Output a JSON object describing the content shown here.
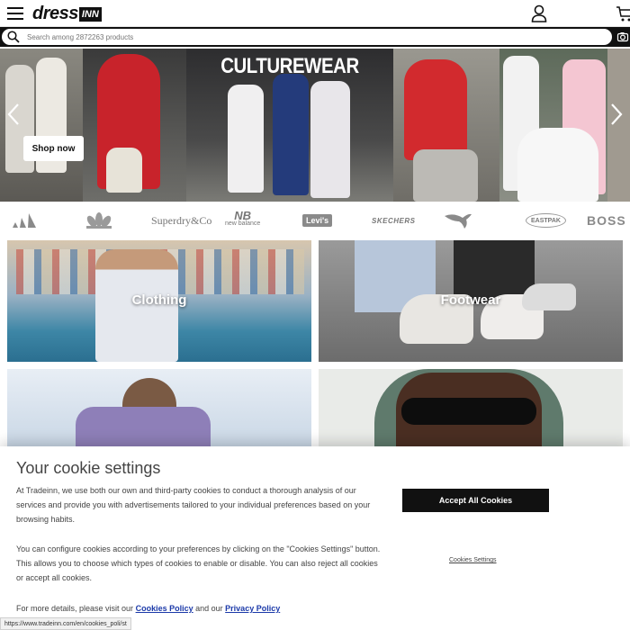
{
  "header": {
    "logo_main": "dress",
    "logo_box": "INN",
    "menu_icon": "hamburger-menu-icon",
    "account_icon": "user-icon",
    "cart_icon": "cart-icon"
  },
  "search": {
    "placeholder": "Search among 2872263 products",
    "icon": "search-icon",
    "camera_icon": "camera-icon"
  },
  "hero": {
    "title": "CULTUREWEAR",
    "cta": "Shop now"
  },
  "brands": [
    {
      "name": "adidas",
      "label": ""
    },
    {
      "name": "adidas originals",
      "label": ""
    },
    {
      "name": "superdry",
      "label": "Superdry&Co"
    },
    {
      "name": "new balance",
      "label": "new balance"
    },
    {
      "name": "levis",
      "label": "Levi's"
    },
    {
      "name": "skechers",
      "label": "SKECHERS"
    },
    {
      "name": "puma",
      "label": ""
    },
    {
      "name": "eastpak",
      "label": "EASTPAK"
    },
    {
      "name": "boss",
      "label": "BOSS"
    }
  ],
  "categories": [
    {
      "label": "Clothing"
    },
    {
      "label": "Footwear"
    },
    {
      "label": ""
    },
    {
      "label": ""
    }
  ],
  "cookie": {
    "title": "Your cookie settings",
    "p1": "At Tradeinn, we use both our own and third-party cookies to conduct a thorough analysis of our services and provide you with advertisements tailored to your individual preferences based on your browsing habits.",
    "p2": "You can configure cookies according to your preferences by clicking on the \"Cookies Settings\" button. This allows you to choose which types of cookies to enable or disable. You can also reject all cookies or accept all cookies.",
    "p3_prefix": "For more details, please visit our",
    "p3_link1": "Cookies Policy",
    "p3_mid": "and our",
    "p3_link2": "Privacy Policy",
    "accept_label": "Accept All Cookies",
    "settings_label": "Cookies Settings"
  },
  "status_url": "https://www.tradeinn.com/en/cookies_poli/st"
}
